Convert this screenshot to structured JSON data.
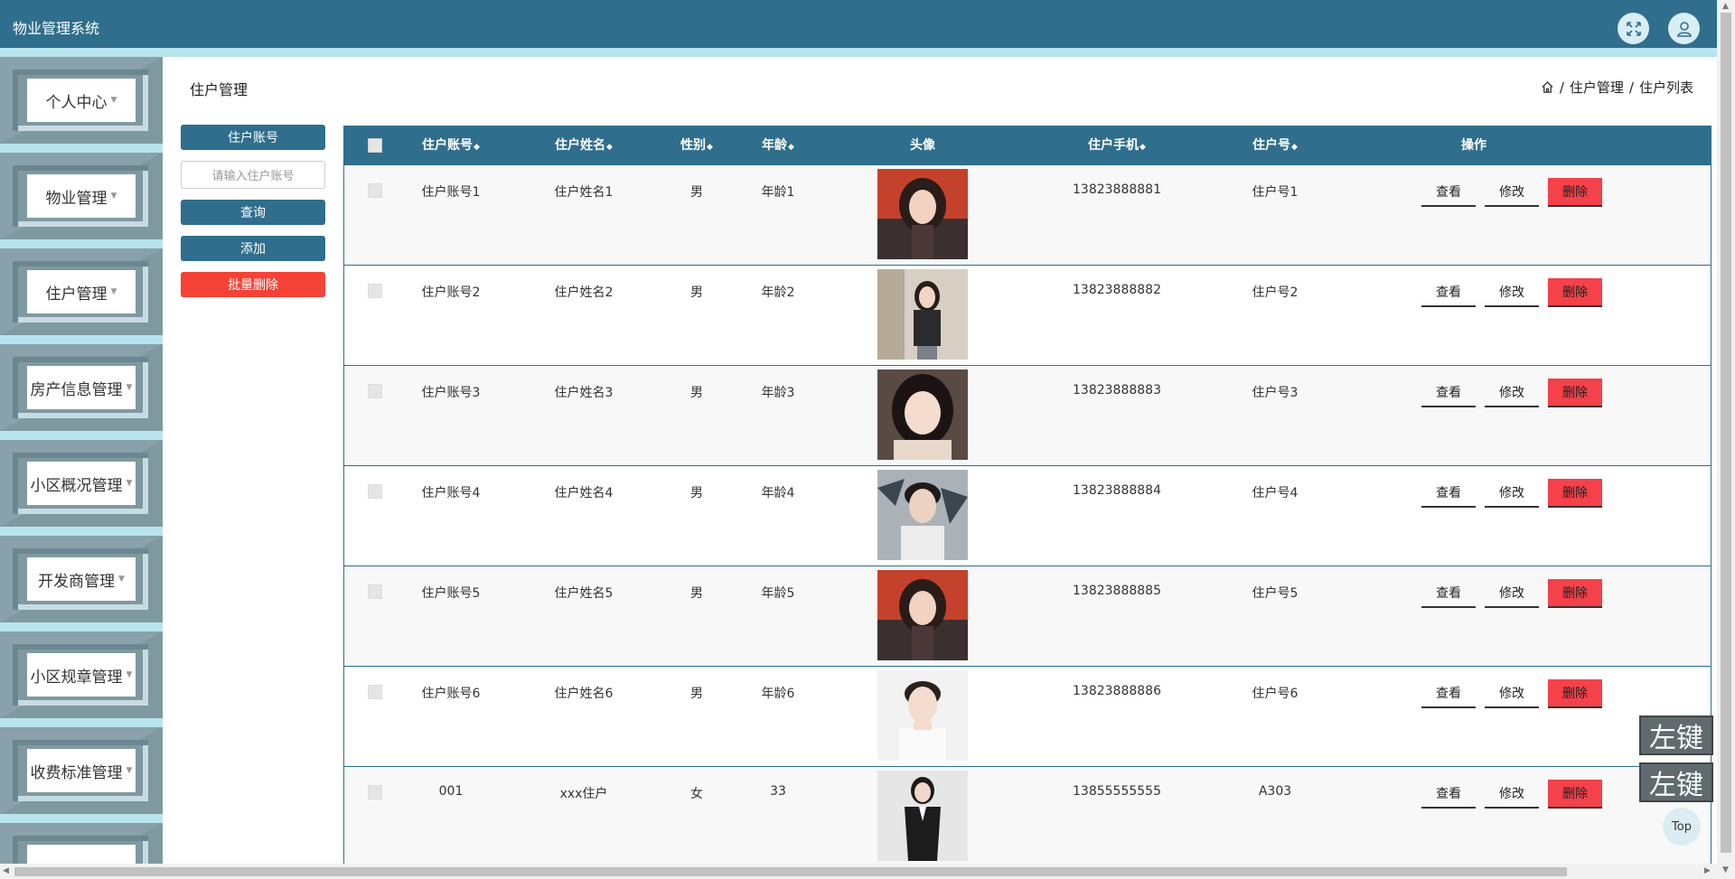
{
  "app": {
    "title": "物业管理系统"
  },
  "header": {
    "fullscreen_icon": "fullscreen-icon",
    "user_icon": "user-icon"
  },
  "sidebar": {
    "items": [
      {
        "label": "个人中心"
      },
      {
        "label": "物业管理"
      },
      {
        "label": "住户管理"
      },
      {
        "label": "房产信息管理"
      },
      {
        "label": "小区概况管理"
      },
      {
        "label": "开发商管理"
      },
      {
        "label": "小区规章管理"
      },
      {
        "label": "收费标准管理"
      }
    ]
  },
  "page": {
    "title": "住户管理"
  },
  "breadcrumb": {
    "items": [
      "住户管理",
      "住户列表"
    ],
    "separator": "/"
  },
  "search": {
    "field_label": "住户账号",
    "placeholder": "请输入住户账号",
    "query_label": "查询",
    "add_label": "添加",
    "batch_delete_label": "批量删除"
  },
  "table": {
    "headers": {
      "account": "住户账号",
      "name": "住户姓名",
      "gender": "性别",
      "age": "年龄",
      "avatar": "头像",
      "phone": "住户手机",
      "unit": "住户号",
      "actions": "操作"
    },
    "sort_glyph": "◆",
    "action_labels": {
      "view": "查看",
      "edit": "修改",
      "delete": "删除"
    },
    "rows": [
      {
        "account": "住户账号1",
        "name": "住户姓名1",
        "gender": "男",
        "age": "年龄1",
        "phone": "13823888881",
        "unit": "住户号1"
      },
      {
        "account": "住户账号2",
        "name": "住户姓名2",
        "gender": "男",
        "age": "年龄2",
        "phone": "13823888882",
        "unit": "住户号2"
      },
      {
        "account": "住户账号3",
        "name": "住户姓名3",
        "gender": "男",
        "age": "年龄3",
        "phone": "13823888883",
        "unit": "住户号3"
      },
      {
        "account": "住户账号4",
        "name": "住户姓名4",
        "gender": "男",
        "age": "年龄4",
        "phone": "13823888884",
        "unit": "住户号4"
      },
      {
        "account": "住户账号5",
        "name": "住户姓名5",
        "gender": "男",
        "age": "年龄5",
        "phone": "13823888885",
        "unit": "住户号5"
      },
      {
        "account": "住户账号6",
        "name": "住户姓名6",
        "gender": "男",
        "age": "年龄6",
        "phone": "13823888886",
        "unit": "住户号6"
      },
      {
        "account": "001",
        "name": "xxx住户",
        "gender": "女",
        "age": "33",
        "phone": "13855555555",
        "unit": "A303"
      }
    ]
  },
  "floating": {
    "key_label_1": "左键",
    "key_label_2": "左键",
    "top_label": "Top"
  },
  "colors": {
    "primary": "#2f6e8c",
    "danger": "#f44336",
    "sidebar_bg": "#b8e4ee"
  }
}
